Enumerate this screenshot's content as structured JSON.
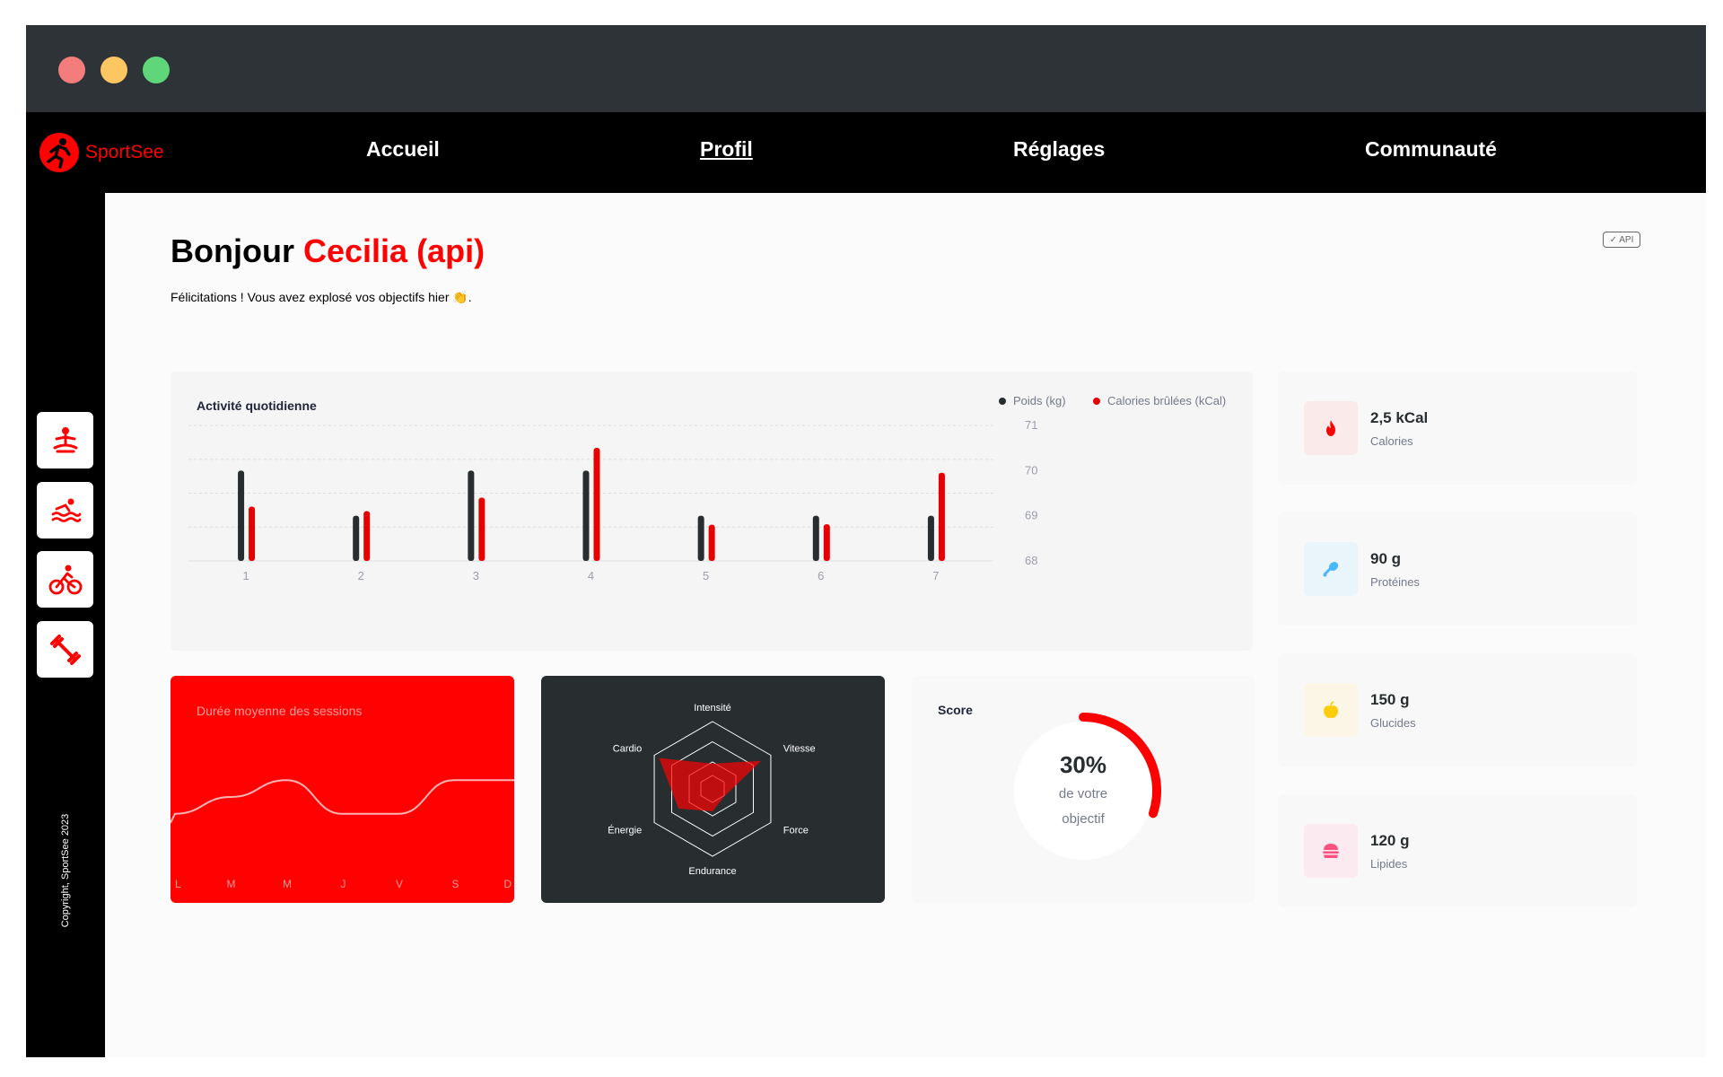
{
  "app": {
    "logo_text": "SportSee"
  },
  "nav": {
    "items": [
      "Accueil",
      "Profil",
      "Réglages",
      "Communauté"
    ],
    "active": "Profil"
  },
  "sidebar": {
    "icons": [
      "yoga-icon",
      "swimming-icon",
      "cycling-icon",
      "dumbbell-icon"
    ],
    "copyright": "Copyright, SportSee 2023"
  },
  "greeting": {
    "prefix": "Bonjour",
    "name": "Cecilia (api)",
    "message": "Félicitations ! Vous avez explosé vos objectifs hier 👏."
  },
  "api_badge": "✓ API",
  "activity": {
    "title": "Activité quotidienne",
    "legend": {
      "weight": "Poids (kg)",
      "calories": "Calories brûlées (kCal)"
    }
  },
  "sessions": {
    "title": "Durée moyenne des sessions"
  },
  "radar_title": "",
  "score": {
    "title": "Score",
    "value": "30%",
    "line1": "de votre",
    "line2": "objectif"
  },
  "kpis": [
    {
      "value": "2,5 kCal",
      "label": "Calories",
      "icon": "flame-icon",
      "bg": "#fbeaea",
      "color": "#ff0000"
    },
    {
      "value": "90 g",
      "label": "Protéines",
      "icon": "drumstick-icon",
      "bg": "#e9f4fb",
      "color": "#4ab8ff"
    },
    {
      "value": "150 g",
      "label": "Glucides",
      "icon": "apple-icon",
      "bg": "#fbf6e5",
      "color": "#fdcc0c"
    },
    {
      "value": "120 g",
      "label": "Lipides",
      "icon": "burger-icon",
      "bg": "#fbeaef",
      "color": "#fd5181"
    }
  ],
  "colors": {
    "brand": "#ff0101",
    "dark": "#282d30",
    "weight_bar": "#282d30",
    "calorie_bar": "#e60000"
  },
  "chart_data": [
    {
      "type": "bar",
      "title": "Activité quotidienne",
      "categories": [
        "1",
        "2",
        "3",
        "4",
        "5",
        "6",
        "7"
      ],
      "series": [
        {
          "name": "Poids (kg)",
          "values": [
            70,
            69,
            70,
            70,
            69,
            69,
            69
          ],
          "axis": "right"
        },
        {
          "name": "Calories brûlées (kCal)",
          "values": [
            240,
            220,
            280,
            500,
            160,
            162,
            390
          ],
          "axis": "hidden"
        }
      ],
      "yticks": [
        68,
        69,
        70,
        71
      ],
      "ylim": [
        68,
        71
      ],
      "calories_lim": [
        0,
        500
      ],
      "grid": true,
      "legend": "top-right"
    },
    {
      "type": "line",
      "title": "Durée moyenne des sessions",
      "categories": [
        "L",
        "M",
        "M",
        "J",
        "V",
        "S",
        "D"
      ],
      "values": [
        30,
        40,
        50,
        30,
        30,
        50,
        50
      ],
      "ylim": [
        0,
        80
      ]
    },
    {
      "type": "radar",
      "axes": [
        "Intensité",
        "Vitesse",
        "Force",
        "Endurance",
        "Énergie",
        "Cardio"
      ],
      "values": [
        90,
        200,
        50,
        80,
        140,
        220
      ],
      "max": 240
    },
    {
      "type": "pie",
      "title": "Score",
      "value": 0.3
    }
  ]
}
